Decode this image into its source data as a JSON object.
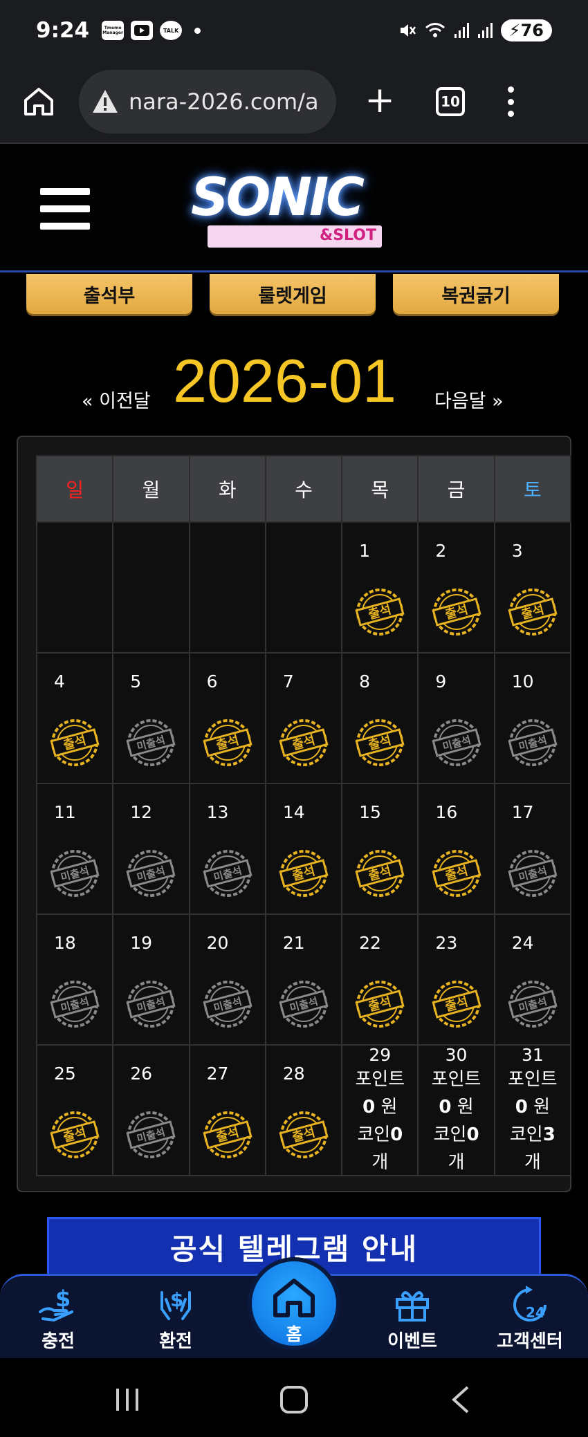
{
  "status_bar": {
    "time": "9:24",
    "app_icons": [
      "Tmemo Manager",
      "youtube-icon",
      "TALK"
    ],
    "battery": "76"
  },
  "browser": {
    "url": "nara-2026.com/a",
    "tab_count": "10"
  },
  "site": {
    "logo_text": "SONIC",
    "logo_sub": "&SLOT"
  },
  "top_buttons": [
    "출석부",
    "룰렛게임",
    "복권긁기"
  ],
  "month_nav": {
    "prev": "« 이전달",
    "title": "2026-01",
    "next": "다음달 »"
  },
  "calendar": {
    "weekdays": [
      "일",
      "월",
      "화",
      "수",
      "목",
      "금",
      "토"
    ],
    "attended_label": "출석",
    "missed_label": "미출석",
    "weeks": [
      [
        null,
        null,
        null,
        null,
        {
          "day": "1",
          "status": "attended"
        },
        {
          "day": "2",
          "status": "attended"
        },
        {
          "day": "3",
          "status": "attended"
        }
      ],
      [
        {
          "day": "4",
          "status": "attended"
        },
        {
          "day": "5",
          "status": "missed"
        },
        {
          "day": "6",
          "status": "attended"
        },
        {
          "day": "7",
          "status": "attended"
        },
        {
          "day": "8",
          "status": "attended"
        },
        {
          "day": "9",
          "status": "missed"
        },
        {
          "day": "10",
          "status": "missed"
        }
      ],
      [
        {
          "day": "11",
          "status": "missed"
        },
        {
          "day": "12",
          "status": "missed"
        },
        {
          "day": "13",
          "status": "missed"
        },
        {
          "day": "14",
          "status": "attended"
        },
        {
          "day": "15",
          "status": "attended"
        },
        {
          "day": "16",
          "status": "attended"
        },
        {
          "day": "17",
          "status": "missed"
        }
      ],
      [
        {
          "day": "18",
          "status": "missed"
        },
        {
          "day": "19",
          "status": "missed"
        },
        {
          "day": "20",
          "status": "missed"
        },
        {
          "day": "21",
          "status": "missed"
        },
        {
          "day": "22",
          "status": "attended"
        },
        {
          "day": "23",
          "status": "attended"
        },
        {
          "day": "24",
          "status": "missed"
        }
      ],
      [
        {
          "day": "25",
          "status": "attended"
        },
        {
          "day": "26",
          "status": "missed"
        },
        {
          "day": "27",
          "status": "attended"
        },
        {
          "day": "28",
          "status": "attended"
        },
        {
          "day": "29",
          "status": "future",
          "point_label": "포인트",
          "point_value": "0",
          "point_unit": "원",
          "coin_label": "코인",
          "coin_value": "0",
          "coin_unit": "개"
        },
        {
          "day": "30",
          "status": "future",
          "point_label": "포인트",
          "point_value": "0",
          "point_unit": "원",
          "coin_label": "코인",
          "coin_value": "0",
          "coin_unit": "개"
        },
        {
          "day": "31",
          "status": "future",
          "point_label": "포인트",
          "point_value": "0",
          "point_unit": "원",
          "coin_label": "코인",
          "coin_value": "3",
          "coin_unit": "개"
        }
      ]
    ]
  },
  "banner": {
    "title": "공식 텔레그램 안내"
  },
  "bottom_nav": {
    "items": [
      "충전",
      "환전",
      "홈",
      "이벤트",
      "고객센터"
    ]
  },
  "colors": {
    "gold": "#f6c624",
    "stamp_gold": "#e8b320",
    "stamp_gray": "#8a8a8a",
    "sunday": "#ff2020",
    "saturday": "#4ab0ff",
    "nav_blue": "#2aa8ff"
  }
}
